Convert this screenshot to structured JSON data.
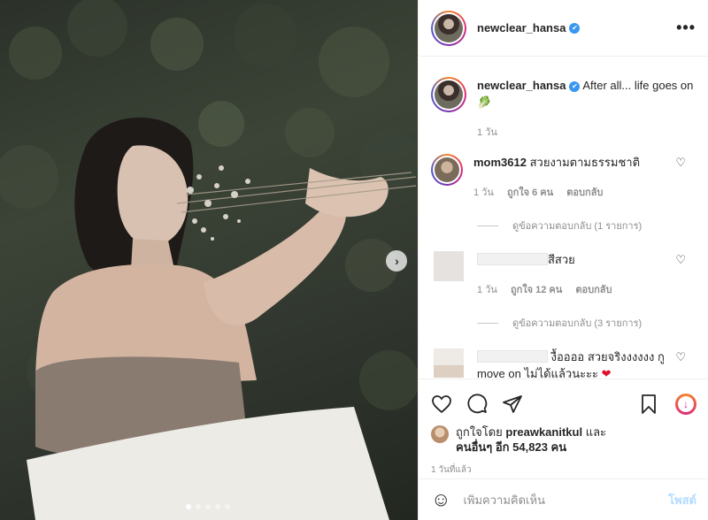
{
  "post": {
    "username": "newclear_hansa",
    "verified_mark": "✔",
    "more_label": "•••",
    "caption_text": "After all... life goes on",
    "caption_emoji": "🥬",
    "caption_age": "1 วัน"
  },
  "comments": [
    {
      "user": "mom3612",
      "text": "สวยงามตามธรรมชาติ",
      "age": "1 วัน",
      "likes": "ถูกใจ 6 คน",
      "reply_label": "ตอบกลับ",
      "view_replies": "ดูข้อความตอบกลับ (1 รายการ)"
    },
    {
      "user": "",
      "text": "สีสวย",
      "age": "1 วัน",
      "likes": "ถูกใจ 12 คน",
      "reply_label": "ตอบกลับ",
      "view_replies": "ดูข้อความตอบกลับ (3 รายการ)"
    },
    {
      "user": "",
      "text": "งื้ออออ สวยจริงงงงงง กู move on ไม่ได้แล้วนะะะ",
      "emoji": "❤"
    }
  ],
  "likes": {
    "prefix": "ถูกใจโดย",
    "user": "preawkanitkul",
    "and": "และ",
    "others": "คนอื่นๆ อีก 54,823 คน"
  },
  "timestamp": "1 วันที่แล้ว",
  "add_comment": {
    "placeholder": "เพิ่มความคิดเห็น",
    "post_label": "โพสต์"
  },
  "icons": {
    "heart": "heart-icon",
    "comment": "comment-icon",
    "share": "share-icon",
    "save": "bookmark-icon",
    "download": "download-icon",
    "emoji": "smile-icon",
    "next": "chevron-right-icon"
  },
  "carousel": {
    "total": 5,
    "active_index": 0
  },
  "colors": {
    "link_blue": "#3897f0",
    "post_button": "#b3dbff",
    "heart_red": "#e0102b"
  }
}
